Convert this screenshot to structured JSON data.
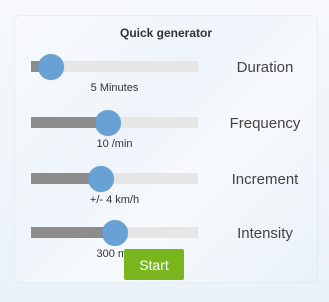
{
  "panel": {
    "title": "Quick generator"
  },
  "sliders": [
    {
      "label": "Duration",
      "value_text": "5 Minutes",
      "position": 0.12
    },
    {
      "label": "Frequency",
      "value_text": "10 /min",
      "position": 0.46
    },
    {
      "label": "Increment",
      "value_text": "+/- 4 km/h",
      "position": 0.42
    },
    {
      "label": "Intensity",
      "value_text": "300 ms",
      "position": 0.5
    }
  ],
  "colors": {
    "knob": "#68a2d4",
    "fill": "#8c8c8c",
    "track": "#e6e6e6",
    "start_button": "#79b61d"
  },
  "actions": {
    "start_label": "Start"
  }
}
